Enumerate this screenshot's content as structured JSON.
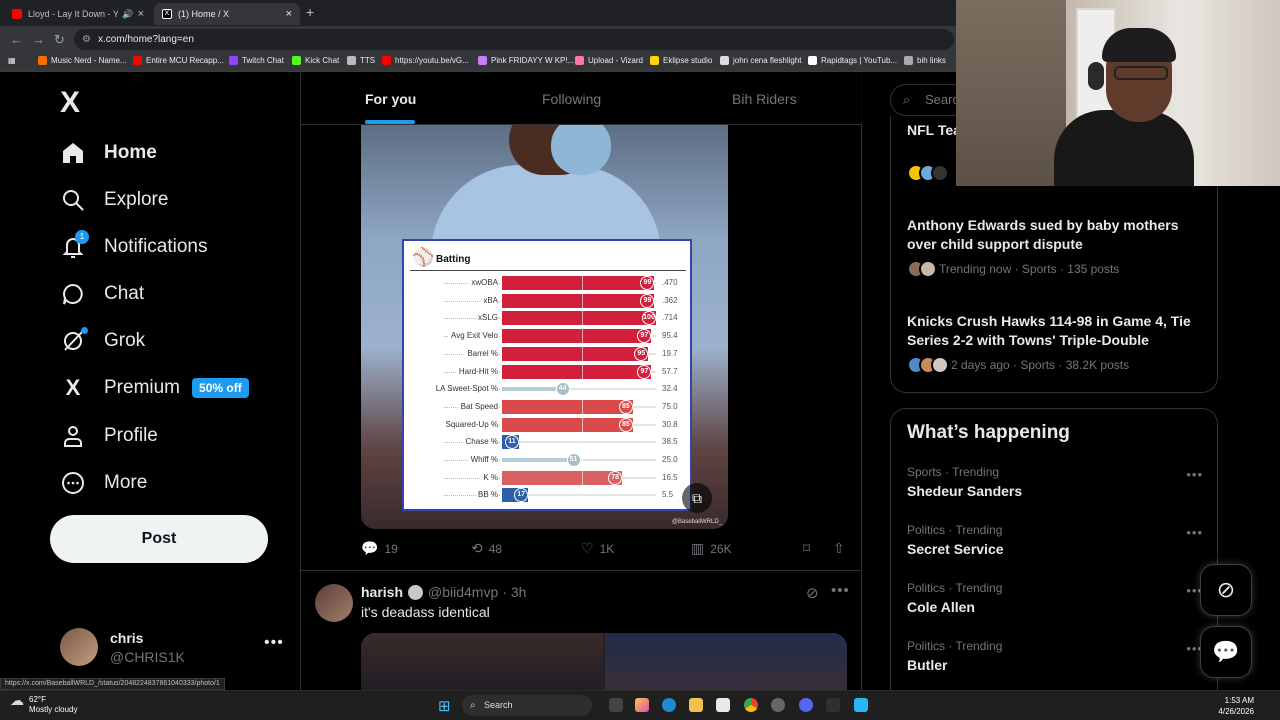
{
  "browser": {
    "tabs": [
      {
        "title": "Lloyd - Lay It Down - YouTube",
        "close": "×",
        "favicon_color": "#ff0000"
      },
      {
        "title": "(1) Home / X",
        "close": "×",
        "favicon_color": "#ffffff"
      }
    ],
    "new_tab": "+",
    "back": "←",
    "forward": "→",
    "reload": "↻",
    "url": "x.com/home?lang=en",
    "bookmarks": [
      {
        "label": "Music Nerd - Name...",
        "color": "#ff6d00"
      },
      {
        "label": "Entire MCU Recapp...",
        "color": "#ff0000"
      },
      {
        "label": "Twitch Chat",
        "color": "#9146ff"
      },
      {
        "label": "Kick Chat",
        "color": "#53fc18"
      },
      {
        "label": "TTS",
        "color": "#bbbbbb"
      },
      {
        "label": "https://youtu.be/vG...",
        "color": "#ff0000"
      },
      {
        "label": "Pink FRIDAYY W KP!...",
        "color": "#c77dff"
      },
      {
        "label": "Upload - Vizard",
        "color": "#ff77aa"
      },
      {
        "label": "Eklipse studio",
        "color": "#ffd400"
      },
      {
        "label": "john cena fleshlight",
        "color": "#dddddd"
      },
      {
        "label": "Rapidtags | YouTub...",
        "color": "#ffffff"
      },
      {
        "label": "bih links",
        "color": "#aaaaaa"
      }
    ]
  },
  "sidebar": {
    "logo": "X",
    "items": [
      {
        "label": "Home",
        "icon": "home-icon",
        "glyph": "⌂"
      },
      {
        "label": "Explore",
        "icon": "search-icon",
        "glyph": "⌕"
      },
      {
        "label": "Notifications",
        "icon": "bell-icon",
        "glyph": "🔔",
        "badge": "1"
      },
      {
        "label": "Chat",
        "icon": "chat-icon",
        "glyph": "◯"
      },
      {
        "label": "Grok",
        "icon": "grok-icon",
        "glyph": "⊘"
      },
      {
        "label": "Premium",
        "icon": "x-icon",
        "glyph": "X",
        "promo": "50% off"
      },
      {
        "label": "Profile",
        "icon": "person-icon",
        "glyph": "⚇"
      },
      {
        "label": "More",
        "icon": "more-circle-icon",
        "glyph": "⋯"
      }
    ],
    "post_button": "Post",
    "account": {
      "name": "chris",
      "handle": "@CHRIS1K",
      "more": "•••"
    },
    "status_url": "https://x.com/BaseballWRLD_/status/2048224837861040333/photo/1"
  },
  "feed": {
    "tabs": [
      "For you",
      "Following",
      "Bih Riders"
    ],
    "active_tab": "For you",
    "post1": {
      "media_credit": "@BaseballWRLD_",
      "card_title": "Batting",
      "actions": {
        "replies": "19",
        "reposts": "48",
        "likes": "1K",
        "views": "26K"
      }
    },
    "post2": {
      "name": "harish",
      "handle": "@biid4mvp",
      "time": "· 3h",
      "text": "it's deadass identical",
      "more": "•••"
    }
  },
  "chart_data": {
    "type": "bar",
    "title": "Batting",
    "categories": [
      "xwOBA",
      "xBA",
      "xSLG",
      "Avg Exit Velo",
      "Barrel %",
      "Hard-Hit %",
      "LA Sweet-Spot %",
      "Bat Speed",
      "Squared-Up %",
      "Chase %",
      "Whiff %",
      "K %",
      "BB %"
    ],
    "percentiles": [
      99,
      99,
      100,
      97,
      95,
      97,
      44,
      85,
      85,
      11,
      51,
      78,
      17
    ],
    "stat_values": [
      ".470",
      ".362",
      ".714",
      "95.4",
      "19.7",
      "57.7",
      "32.4",
      "75.0",
      "30.8",
      "38.5",
      "25.0",
      "16.5",
      "5.5"
    ],
    "colors": [
      "#d21f3c",
      "#d21f3c",
      "#d21f3c",
      "#d21f3c",
      "#d21f3c",
      "#d21f3c",
      "#b5cdd6",
      "#d94b4b",
      "#d94b4b",
      "#2f5ea8",
      "#b5cdd6",
      "#d96060",
      "#2f5ea8"
    ],
    "ylim": [
      0,
      100
    ]
  },
  "right": {
    "search_placeholder": "Search",
    "trends_top": [
      {
        "title": "NFL Teams Signing Undrafted Free Agents",
        "sub": ""
      },
      {
        "title": "Anthony Edwards sued by baby mothers over child support dispute",
        "sub": "Trending now · Sports · 135 posts"
      },
      {
        "title": "Knicks Crush Hawks 114-98 in Game 4, Tie Series 2-2 with Towns' Triple-Double",
        "sub": "2 days ago · Sports · 38.2K posts"
      }
    ],
    "happening_title": "What’s happening",
    "happening": [
      {
        "cat": "Sports · Trending",
        "title": "Shedeur Sanders"
      },
      {
        "cat": "Politics · Trending",
        "title": "Secret Service"
      },
      {
        "cat": "Politics · Trending",
        "title": "Cole Allen"
      },
      {
        "cat": "Politics · Trending",
        "title": "Butler"
      }
    ],
    "dots": "•••"
  },
  "taskbar": {
    "temp": "62°F",
    "condition": "Mostly cloudy",
    "search": "Search",
    "time": "1:53 AM",
    "date": "4/26/2026"
  }
}
